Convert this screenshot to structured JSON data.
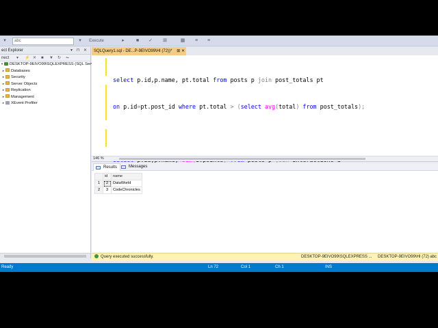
{
  "toolbar": {
    "database_combo": "abc",
    "execute_label": "Execute"
  },
  "object_explorer": {
    "title": "ect Explorer",
    "connect_label": "nect",
    "server": "DESKTOP-9EIVO99\\SQLEXPRESS (SQL Serve",
    "items": [
      "Databases",
      "Security",
      "Server Objects",
      "Replication",
      "Management",
      "XEvent Profiler"
    ]
  },
  "tab": {
    "label": "SQLQuery1.sql - DE...P-9EIVO99\\HI (72))*",
    "icons": "⊞ ✕"
  },
  "editor": {
    "zoom": "146 %",
    "lines": [
      [
        [
          "select p.id,p.name, pt.total ",
          "kw-mixed"
        ]
      ],
      []
    ]
  },
  "results": {
    "tabs": [
      "Results",
      "Messages"
    ],
    "columns": [
      "id",
      "name"
    ],
    "rows": [
      {
        "rownum": "1",
        "id": "2",
        "name": "DataWorld"
      },
      {
        "rownum": "2",
        "id": "3",
        "name": "CodeChronicles"
      }
    ]
  },
  "query_status": {
    "message": "Query executed successfully.",
    "server": "DESKTOP-9EIVO99\\SQLEXPRESS ...",
    "server2": "DESKTOP-9EIVO99\\HI (72)",
    "db": "abc"
  },
  "statusbar": {
    "ready": "Ready",
    "line": "Ln 72",
    "col": "Col 1",
    "ch": "Ch 1",
    "ins": "INS"
  }
}
